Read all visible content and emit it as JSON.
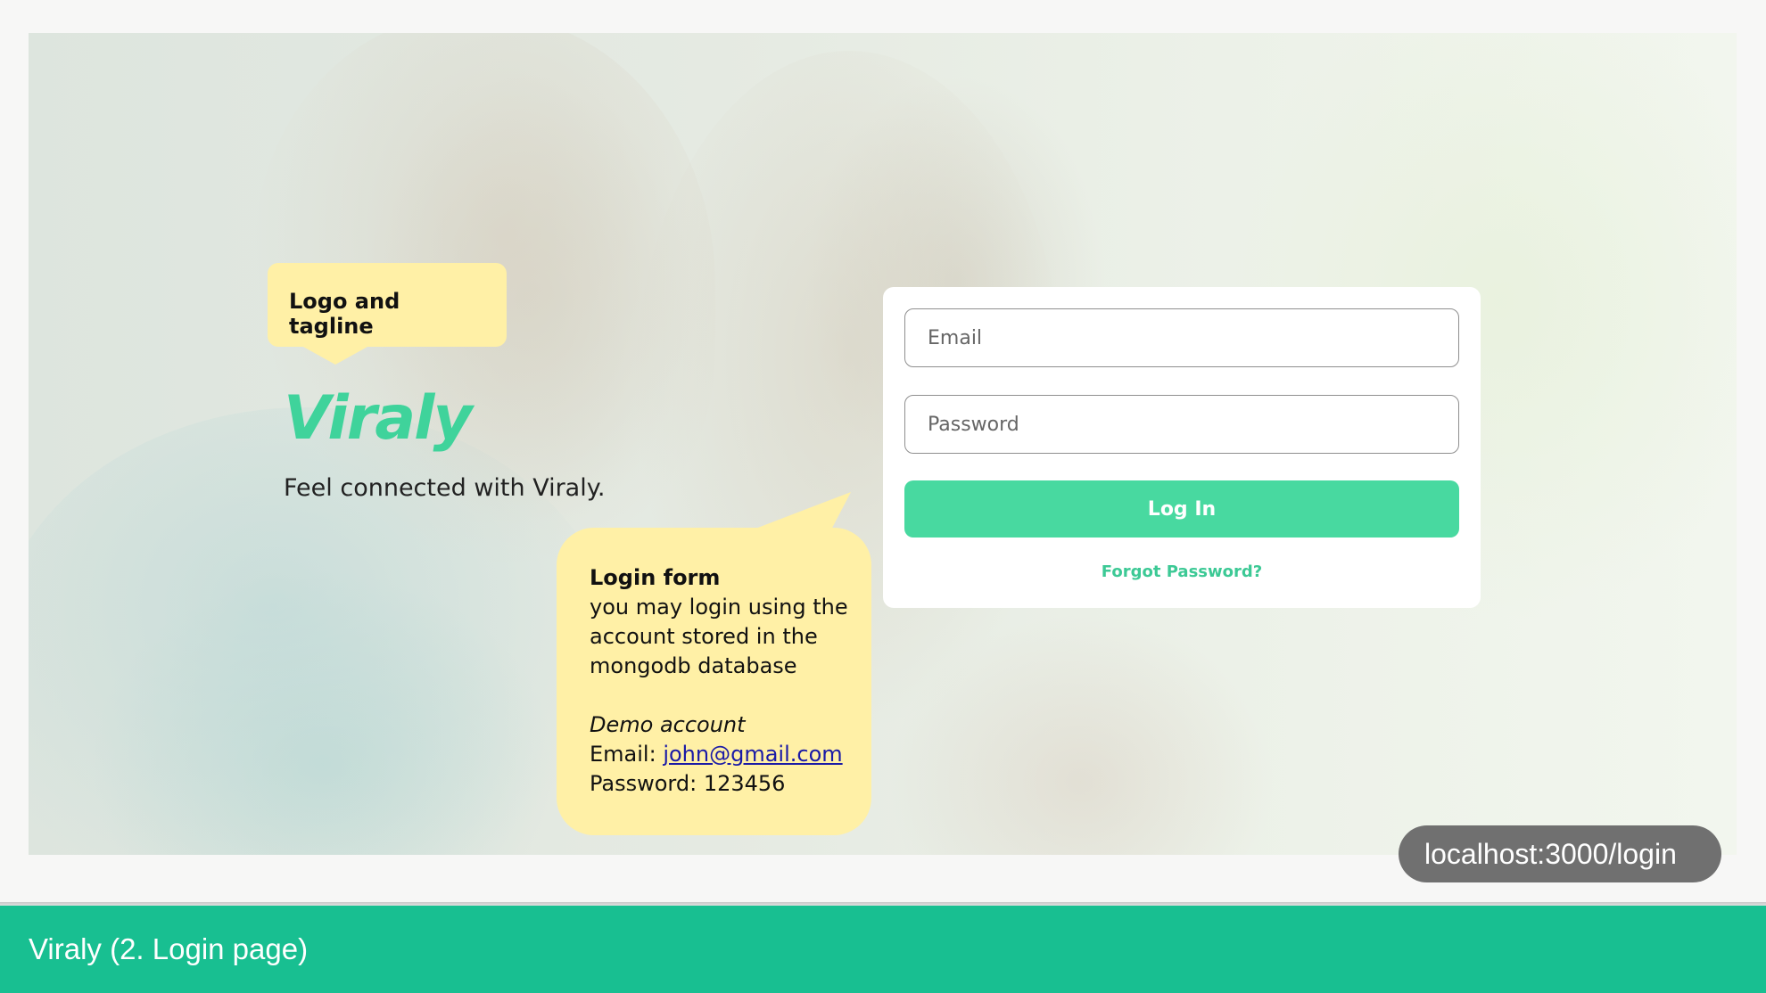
{
  "brand": {
    "logo": "Viraly",
    "tagline": "Feel connected with Viraly."
  },
  "callouts": {
    "logo_tagline": "Logo and tagline",
    "login_form": {
      "title": "Login form",
      "description": "you may login using the account stored in the mongodb database",
      "demo_label": "Demo account",
      "email_prefix": "Email: ",
      "email_value": "john@gmail.com",
      "password_prefix": "Password: ",
      "password_value": "123456"
    }
  },
  "login_form": {
    "email_placeholder": "Email",
    "password_placeholder": "Password",
    "submit_label": "Log In",
    "forgot_password": "Forgot Password?"
  },
  "address_bar": {
    "url": "localhost:3000/login"
  },
  "footer": {
    "title": "Viraly (2. Login page)"
  },
  "colors": {
    "accent": "#48d9a0",
    "footer_bg": "#18bf91",
    "callout_bg": "#fff0a6"
  }
}
